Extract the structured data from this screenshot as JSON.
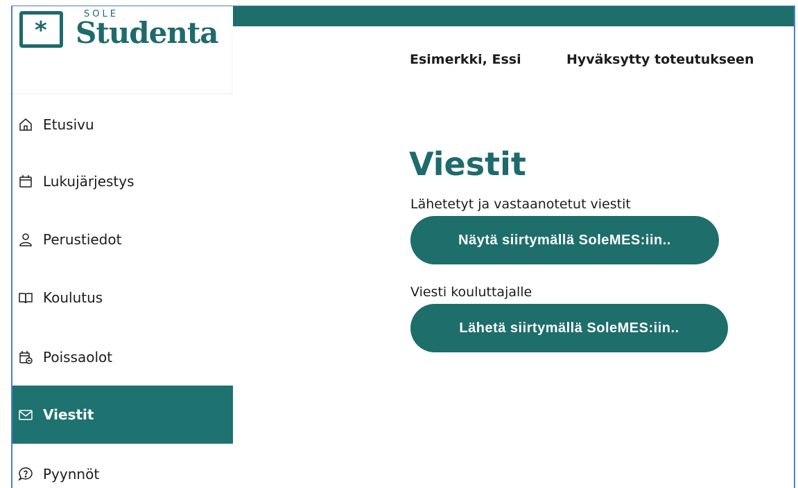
{
  "logo": {
    "brand_small": "SOLE",
    "brand_name": "Studenta"
  },
  "header": {
    "user_name": "Esimerkki, Essi",
    "user_status": "Hyväksytty toteutukseen"
  },
  "sidebar": {
    "items": [
      {
        "label": "Etusivu",
        "icon": "home-icon",
        "active": false
      },
      {
        "label": "Lukujärjestys",
        "icon": "calendar-icon",
        "active": false
      },
      {
        "label": "Perustiedot",
        "icon": "person-icon",
        "active": false
      },
      {
        "label": "Koulutus",
        "icon": "book-icon",
        "active": false
      },
      {
        "label": "Poissaolot",
        "icon": "calendar-absence-icon",
        "active": false
      },
      {
        "label": "Viestit",
        "icon": "envelope-icon",
        "active": true
      },
      {
        "label": "Pyynnöt",
        "icon": "question-bubble-icon",
        "active": false
      }
    ]
  },
  "main": {
    "title": "Viestit",
    "sent_received_label": "Lähetetyt ja vastaanotetut viestit",
    "show_button": "Näytä siirtymällä SoleMES:iin..",
    "message_trainer_label": "Viesti kouluttajalle",
    "send_button": "Lähetä siirtymällä SoleMES:iin.."
  },
  "colors": {
    "brand": "#1e6a6c",
    "accent": "#1e7270",
    "text": "#1c1c1c"
  }
}
